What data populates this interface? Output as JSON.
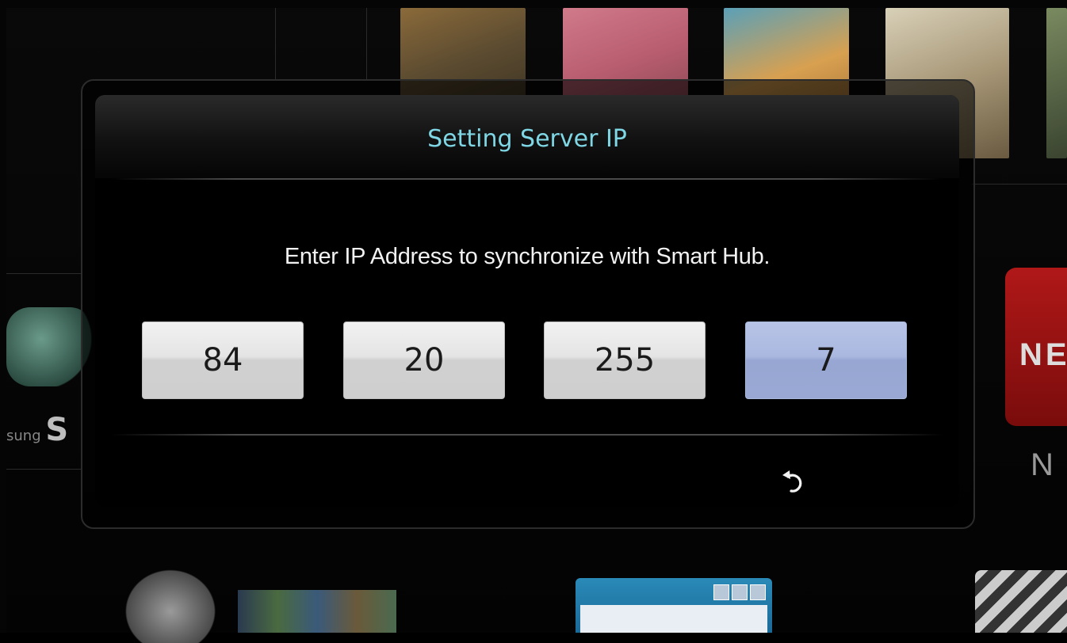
{
  "dialog": {
    "title": "Setting Server IP",
    "instruction": "Enter IP Address to synchronize with Smart Hub.",
    "ip_octets": [
      "84",
      "20",
      "255",
      "7"
    ],
    "active_octet_index": 3,
    "return_icon": "return-icon"
  },
  "background": {
    "samsung_small": "sung",
    "samsung_big": "S",
    "netflix_partial": "NE",
    "n_partial": "N"
  },
  "colors": {
    "title": "#7fd6e4",
    "active_field": "#aab8e0",
    "field": "#e4e4e4"
  }
}
